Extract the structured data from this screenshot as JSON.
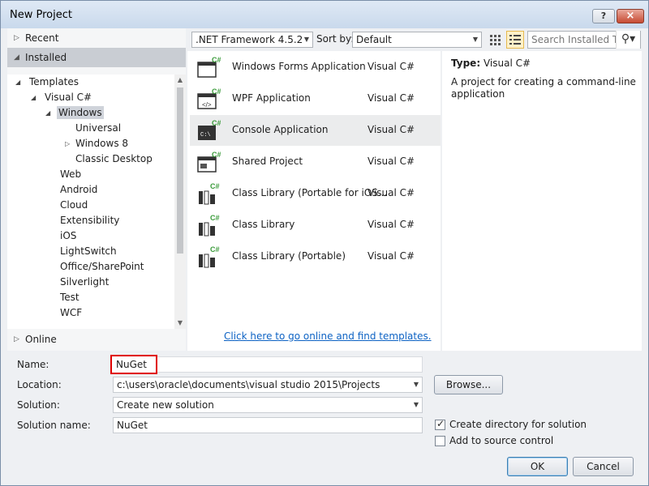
{
  "window": {
    "title": "New Project",
    "help_label": "?",
    "close_label": "×"
  },
  "left": {
    "recent": "Recent",
    "installed": "Installed",
    "online": "Online",
    "tree": [
      {
        "label": "Templates"
      },
      {
        "label": "Visual C#"
      },
      {
        "label": "Windows"
      },
      {
        "label": "Universal"
      },
      {
        "label": "Windows 8"
      },
      {
        "label": "Classic Desktop"
      },
      {
        "label": "Web"
      },
      {
        "label": "Android"
      },
      {
        "label": "Cloud"
      },
      {
        "label": "Extensibility"
      },
      {
        "label": "iOS"
      },
      {
        "label": "LightSwitch"
      },
      {
        "label": "Office/SharePoint"
      },
      {
        "label": "Silverlight"
      },
      {
        "label": "Test"
      },
      {
        "label": "WCF"
      }
    ]
  },
  "toolbar": {
    "framework": ".NET Framework 4.5.2",
    "sort_label": "Sort by:",
    "sort_value": "Default",
    "search_placeholder": "Search Installed Te"
  },
  "templates": [
    {
      "name": "Windows Forms Application",
      "lang": "Visual C#"
    },
    {
      "name": "WPF Application",
      "lang": "Visual C#"
    },
    {
      "name": "Console Application",
      "lang": "Visual C#"
    },
    {
      "name": "Shared Project",
      "lang": "Visual C#"
    },
    {
      "name": "Class Library (Portable for iOS...",
      "lang": "Visual C#"
    },
    {
      "name": "Class Library",
      "lang": "Visual C#"
    },
    {
      "name": "Class Library (Portable)",
      "lang": "Visual C#"
    }
  ],
  "online_link": "Click here to go online and find templates.",
  "description": {
    "type_label": "Type:",
    "type_value": "Visual C#",
    "text": "A project for creating a command-line application"
  },
  "form": {
    "name_label": "Name:",
    "name_value": "NuGet",
    "location_label": "Location:",
    "location_value": "c:\\users\\oracle\\documents\\visual studio 2015\\Projects",
    "solution_label": "Solution:",
    "solution_value": "Create new solution",
    "solution_name_label": "Solution name:",
    "solution_name_value": "NuGet",
    "browse": "Browse...",
    "create_dir_label": "Create directory for solution",
    "create_dir_checked": true,
    "source_control_label": "Add to source control",
    "source_control_checked": false,
    "ok": "OK",
    "cancel": "Cancel"
  }
}
